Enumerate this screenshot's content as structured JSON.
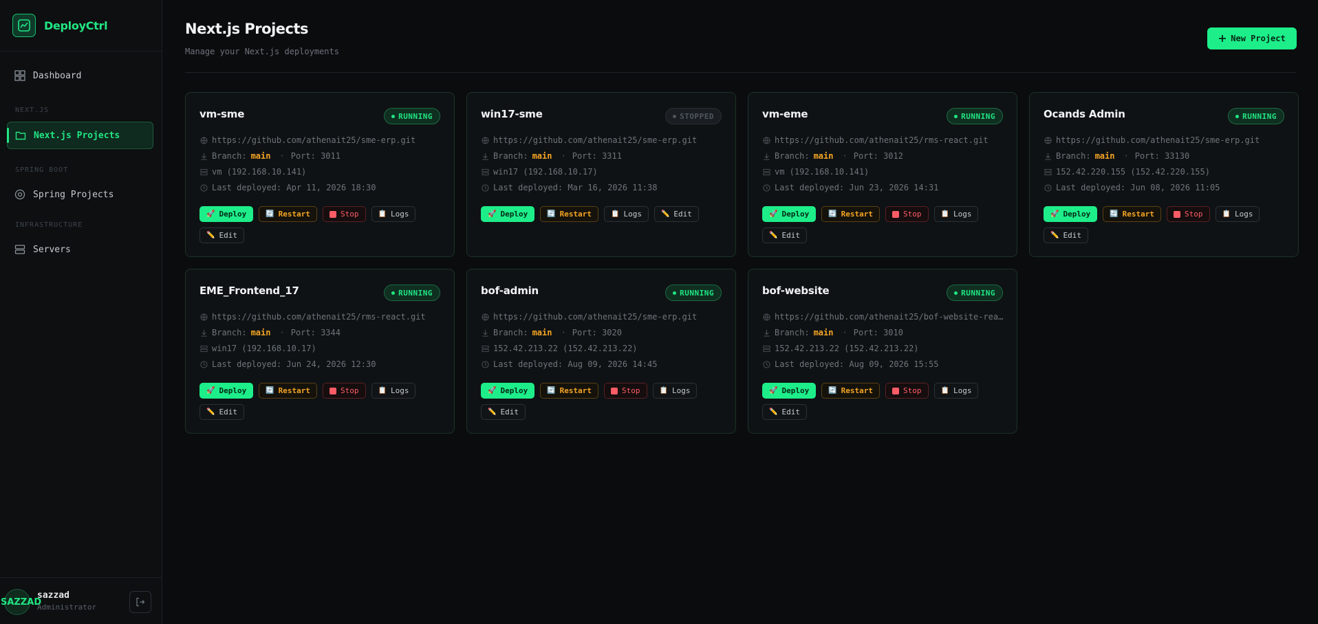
{
  "app": {
    "name": "DeployCtrl"
  },
  "sidebar": {
    "dashboard": "Dashboard",
    "sections": [
      "NEXT.JS",
      "SPRING BOOT",
      "INFRASTRUCTURE"
    ],
    "nextjs_projects": "Next.js Projects",
    "spring_projects": "Spring Projects",
    "servers": "Servers"
  },
  "user": {
    "avatar_text": "SAZZAD",
    "name": "sazzad",
    "role": "Administrator"
  },
  "header": {
    "title": "Next.js Projects",
    "subtitle": "Manage your Next.js deployments",
    "new_project": "New Project"
  },
  "labels": {
    "branch": "Branch:",
    "port": "Port:",
    "last_deployed": "Last deployed:",
    "deploy": "Deploy",
    "restart": "Restart",
    "stop": "Stop",
    "logs": "Logs",
    "edit": "Edit",
    "sep": "·"
  },
  "colors": {
    "accent": "#1dee8a",
    "branch": "#f5a524",
    "stop": "#ff5c66"
  },
  "projects": [
    {
      "name": "vm-sme",
      "status": "RUNNING",
      "repo": "https://github.com/athenait25/sme-erp.git",
      "branch": "main",
      "port": "3011",
      "server": "vm (192.168.10.141)",
      "deployed": "Apr 11, 2026 18:30"
    },
    {
      "name": "win17-sme",
      "status": "STOPPED",
      "repo": "https://github.com/athenait25/sme-erp.git",
      "branch": "main",
      "port": "3311",
      "server": "win17 (192.168.10.17)",
      "deployed": "Mar 16, 2026 11:38"
    },
    {
      "name": "vm-eme",
      "status": "RUNNING",
      "repo": "https://github.com/athenait25/rms-react.git",
      "branch": "main",
      "port": "3012",
      "server": "vm (192.168.10.141)",
      "deployed": "Jun 23, 2026 14:31"
    },
    {
      "name": "Ocands Admin",
      "status": "RUNNING",
      "repo": "https://github.com/athenait25/sme-erp.git",
      "branch": "main",
      "port": "33130",
      "server": "152.42.220.155 (152.42.220.155)",
      "deployed": "Jun 08, 2026 11:05"
    },
    {
      "name": "EME_Frontend_17",
      "status": "RUNNING",
      "repo": "https://github.com/athenait25/rms-react.git",
      "branch": "main",
      "port": "3344",
      "server": "win17 (192.168.10.17)",
      "deployed": "Jun 24, 2026 12:30"
    },
    {
      "name": "bof-admin",
      "status": "RUNNING",
      "repo": "https://github.com/athenait25/sme-erp.git",
      "branch": "main",
      "port": "3020",
      "server": "152.42.213.22 (152.42.213.22)",
      "deployed": "Aug 09, 2026 14:45"
    },
    {
      "name": "bof-website",
      "status": "RUNNING",
      "repo": "https://github.com/athenait25/bof-website-rea…",
      "branch": "main",
      "port": "3010",
      "server": "152.42.213.22 (152.42.213.22)",
      "deployed": "Aug 09, 2026 15:55"
    }
  ]
}
